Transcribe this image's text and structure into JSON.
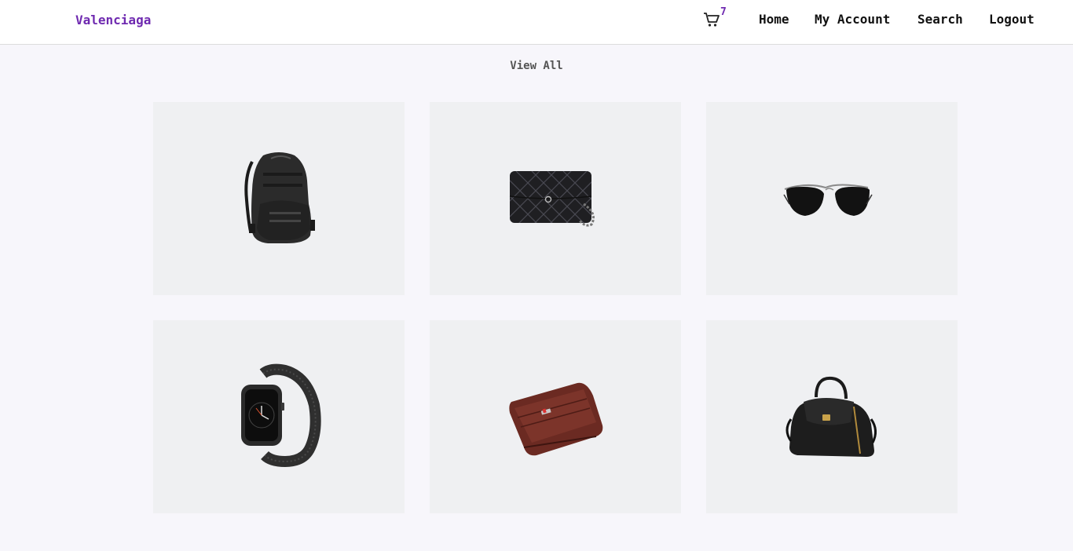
{
  "header": {
    "brand": "Valenciaga",
    "cart": {
      "count": "7",
      "icon": "cart-icon"
    },
    "nav": {
      "home": "Home",
      "account": "My Account",
      "search": "Search",
      "logout": "Logout"
    }
  },
  "main": {
    "view_all": "View All",
    "products": [
      {
        "icon": "backpack-image"
      },
      {
        "icon": "quilted-clutch-image"
      },
      {
        "icon": "aviator-sunglasses-image"
      },
      {
        "icon": "smartwatch-image"
      },
      {
        "icon": "wallet-image"
      },
      {
        "icon": "handbag-image"
      }
    ]
  },
  "colors": {
    "brand": "#6f2ab0",
    "page_bg": "#f7f6fb",
    "card_bg": "#eff0f2"
  }
}
